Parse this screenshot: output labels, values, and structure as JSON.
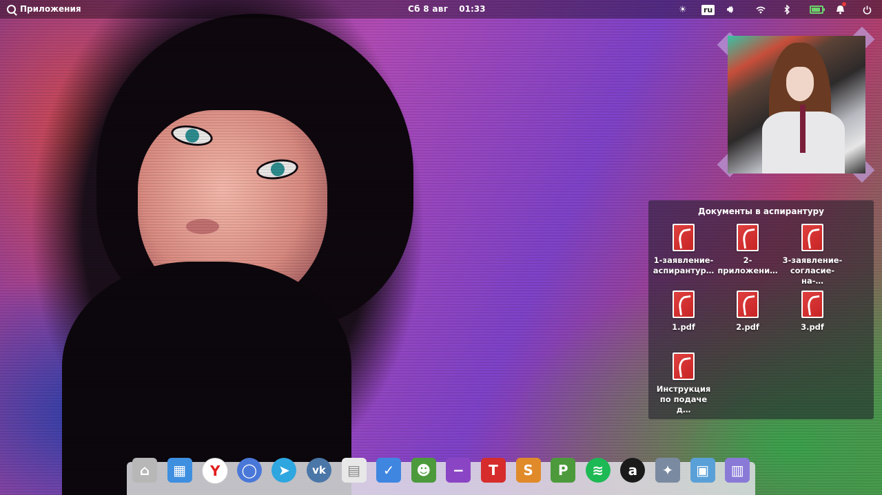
{
  "panel": {
    "apps_label": "Приложения",
    "day": "Сб",
    "date": "8 авг",
    "time": "01:33",
    "keyboard_layout": "ru"
  },
  "folder": {
    "title": "Документы в аспирантуру",
    "files": [
      {
        "label_line1": "1-заявление-",
        "label_line2": "аспирантур…"
      },
      {
        "label_line1": "2-",
        "label_line2": "приложени…"
      },
      {
        "label_line1": "3-заявление-",
        "label_line2": "согласие-на-…"
      },
      {
        "label_line1": "1.pdf",
        "label_line2": ""
      },
      {
        "label_line1": "2.pdf",
        "label_line2": ""
      },
      {
        "label_line1": "3.pdf",
        "label_line2": ""
      },
      {
        "label_line1": "Инструкция",
        "label_line2": "по подаче д…"
      }
    ]
  },
  "dock": {
    "items": [
      {
        "name": "files-icon",
        "glyph": "⌂",
        "color": "#b7b7b7"
      },
      {
        "name": "multitasking-icon",
        "glyph": "▦",
        "color": "#3f8fe0"
      },
      {
        "name": "yandex-browser-icon",
        "glyph": "Y",
        "color": "#ffffff"
      },
      {
        "name": "chromium-icon",
        "glyph": "◯",
        "color": "#4a78d8"
      },
      {
        "name": "telegram-icon",
        "glyph": "➤",
        "color": "#2ea6e0"
      },
      {
        "name": "vk-icon",
        "glyph": "vk",
        "color": "#4a76a8"
      },
      {
        "name": "calendar-icon",
        "glyph": "▤",
        "color": "#e8e8e8"
      },
      {
        "name": "tasks-icon",
        "glyph": "✓",
        "color": "#3f86e0"
      },
      {
        "name": "contacts-icon",
        "glyph": "☻",
        "color": "#4c9a3c"
      },
      {
        "name": "notes-icon",
        "glyph": "−",
        "color": "#8a45c4"
      },
      {
        "name": "textmaker-icon",
        "glyph": "T",
        "color": "#d62c2c"
      },
      {
        "name": "planmaker-icon",
        "glyph": "S",
        "color": "#e08a2a"
      },
      {
        "name": "presentations-icon",
        "glyph": "P",
        "color": "#4c9a3c"
      },
      {
        "name": "spotify-icon",
        "glyph": "≋",
        "color": "#1db954"
      },
      {
        "name": "amazon-icon",
        "glyph": "a",
        "color": "#1a1a1a"
      },
      {
        "name": "video-editor-icon",
        "glyph": "✦",
        "color": "#7a8aa0"
      },
      {
        "name": "photos-icon",
        "glyph": "▣",
        "color": "#5aa0d8"
      },
      {
        "name": "app-center-icon",
        "glyph": "▥",
        "color": "#8a7ad8"
      }
    ]
  }
}
